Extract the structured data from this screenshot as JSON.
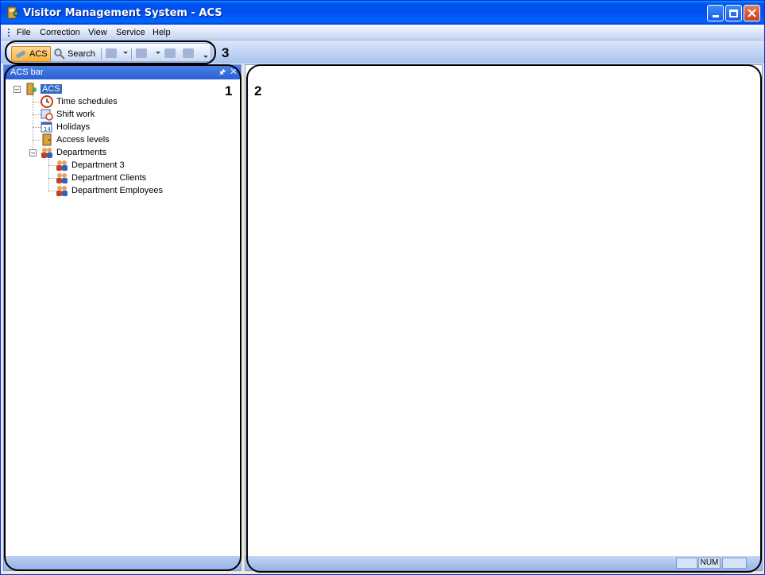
{
  "window": {
    "title": "Visitor Management System - ACS",
    "controls": [
      "minimize-icon",
      "maximize-icon",
      "close-icon"
    ]
  },
  "menu": {
    "items": [
      "File",
      "Correction",
      "View",
      "Service",
      "Help"
    ]
  },
  "toolbar": {
    "acs_label": "ACS",
    "search_label": "Search"
  },
  "panel": {
    "title": "ACS bar"
  },
  "tree": {
    "root": "ACS",
    "items": [
      "Time schedules",
      "Shift work",
      "Holidays",
      "Access levels"
    ],
    "departments_label": "Departments",
    "departments": [
      "Department 3",
      "Department Clients",
      "Department Employees"
    ]
  },
  "statusbar": {
    "num": "NUM"
  },
  "callouts": {
    "one": "1",
    "two": "2",
    "three": "3"
  },
  "colors": {
    "title_bar": "#0053ee",
    "selection": "#316ac5",
    "panel_header": "#2b5fd4"
  }
}
